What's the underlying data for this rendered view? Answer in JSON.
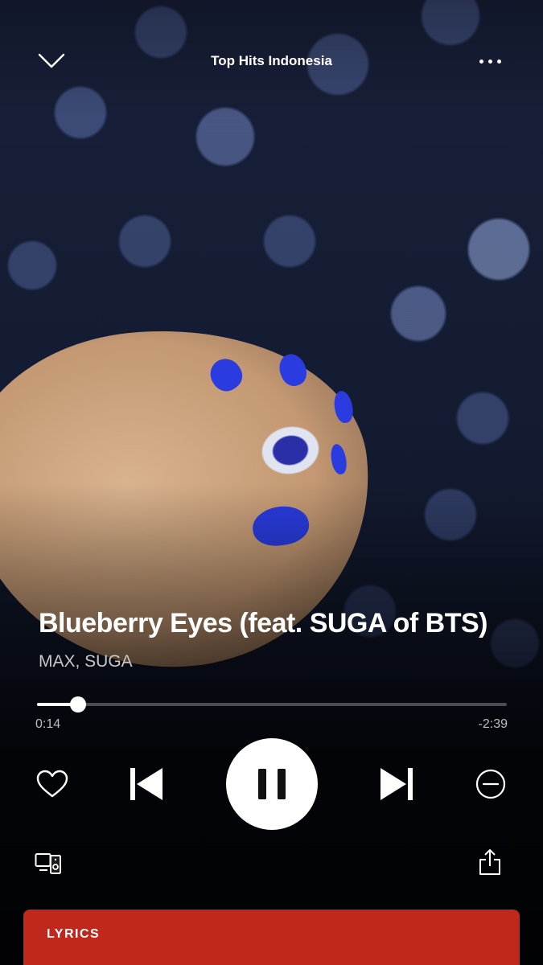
{
  "header": {
    "playlist_title": "Top Hits Indonesia",
    "collapse_icon": "chevron-down-icon",
    "more_icon": "more-dots-icon"
  },
  "track": {
    "title": "Blueberry Eyes (feat. SUGA of BTS)",
    "artist": "MAX, SUGA"
  },
  "playback": {
    "elapsed": "0:14",
    "remaining": "-2:39",
    "progress_fraction": 0.0874
  },
  "controls": {
    "like_icon": "heart-outline-icon",
    "previous_icon": "skip-previous-icon",
    "play_pause_icon": "pause-icon",
    "next_icon": "skip-next-icon",
    "hide_icon": "minus-circle-icon"
  },
  "utility": {
    "devices_icon": "devices-icon",
    "share_icon": "share-icon"
  },
  "lyrics": {
    "label": "LYRICS",
    "card_color": "#c0281d"
  },
  "colors": {
    "text_primary": "#ffffff",
    "text_secondary": "#c8c8c8",
    "accent_lyrics": "#c0281d"
  }
}
